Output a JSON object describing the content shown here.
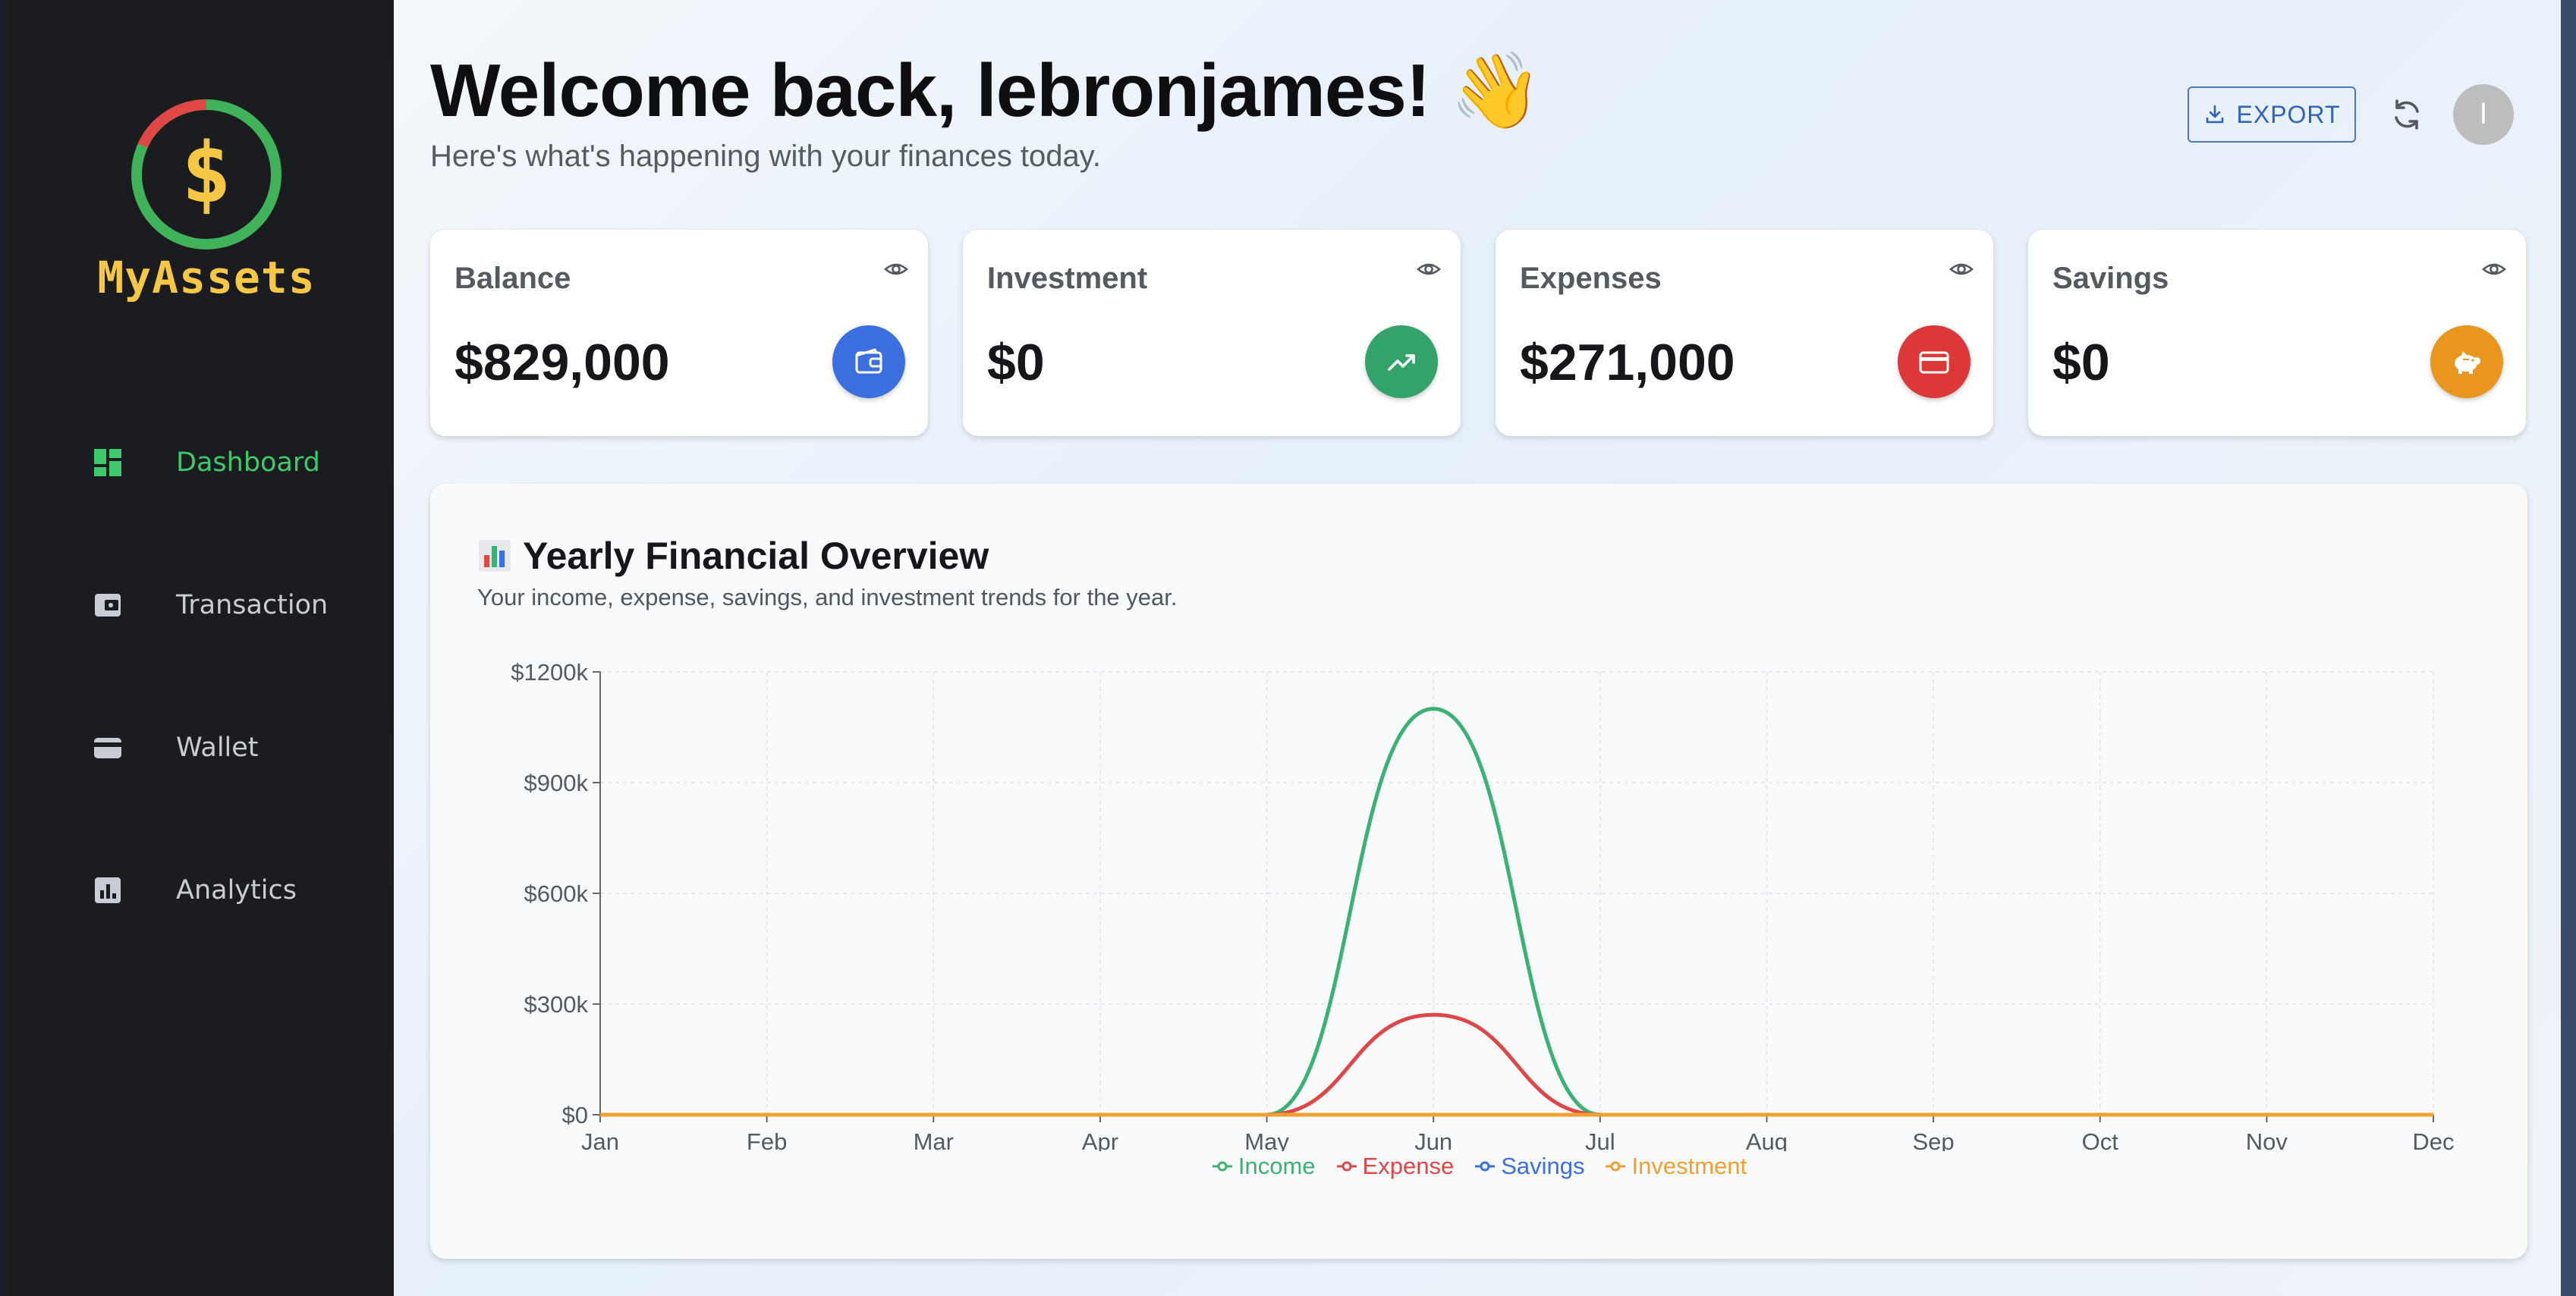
{
  "app": {
    "name": "MyAssets",
    "logo_symbol": "$"
  },
  "sidebar": {
    "items": [
      {
        "label": "Dashboard",
        "icon": "dashboard-icon",
        "active": true
      },
      {
        "label": "Transaction",
        "icon": "wallet-card-icon",
        "active": false
      },
      {
        "label": "Wallet",
        "icon": "wallet-icon",
        "active": false
      },
      {
        "label": "Analytics",
        "icon": "analytics-icon",
        "active": false
      }
    ]
  },
  "header": {
    "greeting": "Welcome back, lebronjames! 👋",
    "subtitle": "Here's what's happening with your finances today.",
    "export_label": "EXPORT",
    "avatar_letter": "l"
  },
  "cards": [
    {
      "title": "Balance",
      "value": "$829,000",
      "icon": "wallet-icon",
      "color": "#3b6fe0"
    },
    {
      "title": "Investment",
      "value": "$0",
      "icon": "trending-up-icon",
      "color": "#34a36a"
    },
    {
      "title": "Expenses",
      "value": "$271,000",
      "icon": "credit-card-icon",
      "color": "#dc3838"
    },
    {
      "title": "Savings",
      "value": "$0",
      "icon": "piggy-bank-icon",
      "color": "#e8961e"
    }
  ],
  "chart": {
    "title": "Yearly Financial Overview",
    "subtitle": "Your income, expense, savings, and investment trends for the year."
  },
  "chart_data": {
    "type": "line",
    "categories": [
      "Jan",
      "Feb",
      "Mar",
      "Apr",
      "May",
      "Jun",
      "Jul",
      "Aug",
      "Sep",
      "Oct",
      "Nov",
      "Dec"
    ],
    "y_ticks": [
      "$0",
      "$300k",
      "$600k",
      "$900k",
      "$1200k"
    ],
    "ylim": [
      0,
      1200000
    ],
    "grid": true,
    "legend_position": "bottom",
    "series": [
      {
        "name": "Income",
        "color": "#3bb273",
        "values": [
          0,
          0,
          0,
          0,
          0,
          1100000,
          0,
          0,
          0,
          0,
          0,
          0
        ]
      },
      {
        "name": "Expense",
        "color": "#e04646",
        "values": [
          0,
          0,
          0,
          0,
          0,
          271000,
          0,
          0,
          0,
          0,
          0,
          0
        ]
      },
      {
        "name": "Savings",
        "color": "#3b6fe0",
        "values": [
          0,
          0,
          0,
          0,
          0,
          0,
          0,
          0,
          0,
          0,
          0,
          0
        ]
      },
      {
        "name": "Investment",
        "color": "#f0a030",
        "values": [
          0,
          0,
          0,
          0,
          0,
          0,
          0,
          0,
          0,
          0,
          0,
          0
        ]
      }
    ]
  }
}
